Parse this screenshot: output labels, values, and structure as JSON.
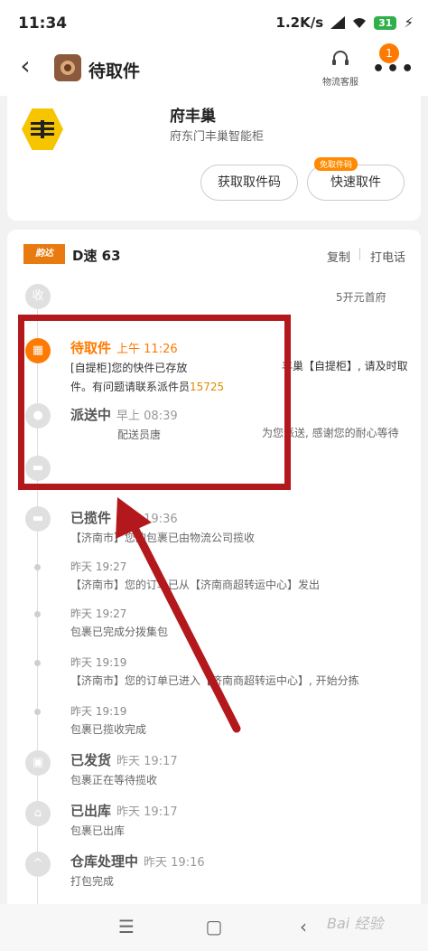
{
  "status_bar": {
    "time": "11:34",
    "speed": "1.2K/s",
    "battery": "31"
  },
  "header": {
    "title": "待取件",
    "service_label": "物流客服",
    "more_icon": "more-icon",
    "notification_count": "1"
  },
  "locker": {
    "name": "府丰巢",
    "address": "府东门丰巢智能柜",
    "get_code_label": "获取取件码",
    "fast_pickup_label": "快速取件",
    "promo_tag": "免取件码"
  },
  "tracking": {
    "courier_logo": "韵达",
    "tracking_no": "D速 63",
    "copy_label": "复制",
    "call_label": "打电话",
    "collect_node": "收",
    "address_partial": "5开元首府",
    "events": [
      {
        "status": "待取件",
        "time": "上午 11:26",
        "desc_a": "[自提柜]您的快件已存放",
        "desc_a_right": "丰巢【自提柜】, 请及时取",
        "desc_b": "件。有问题请联系派件员",
        "phone": "15725"
      },
      {
        "status": "派送中",
        "time": "早上 08:39",
        "desc_a": "配送员唐",
        "desc_a_right": "为您派送, 感谢您的耐心等待"
      },
      {
        "status": "已揽件",
        "time": "昨天 19:36",
        "desc": "【济南市】您的包裹已由物流公司揽收"
      },
      {
        "time": "昨天 19:27",
        "desc": "【济南市】您的订单已从【济南商超转运中心】发出"
      },
      {
        "time": "昨天 19:27",
        "desc": "包裹已完成分拨集包"
      },
      {
        "time": "昨天 19:19",
        "desc": "【济南市】您的订单已进入【济南商超转运中心】, 开始分拣"
      },
      {
        "time": "昨天 19:19",
        "desc": "包裹已揽收完成"
      },
      {
        "status": "已发货",
        "time": "昨天 19:17",
        "desc": "包裹正在等待揽收"
      },
      {
        "status": "已出库",
        "time": "昨天 19:17",
        "desc": "包裹已出库"
      },
      {
        "status": "仓库处理中",
        "time": "昨天 19:16",
        "desc": "打包完成"
      }
    ]
  },
  "navbar": {
    "watermark": "Bai 经验"
  },
  "colors": {
    "accent": "#ff7a00",
    "annotation_red": "#b3191c",
    "locker_yellow": "#f7c400"
  }
}
